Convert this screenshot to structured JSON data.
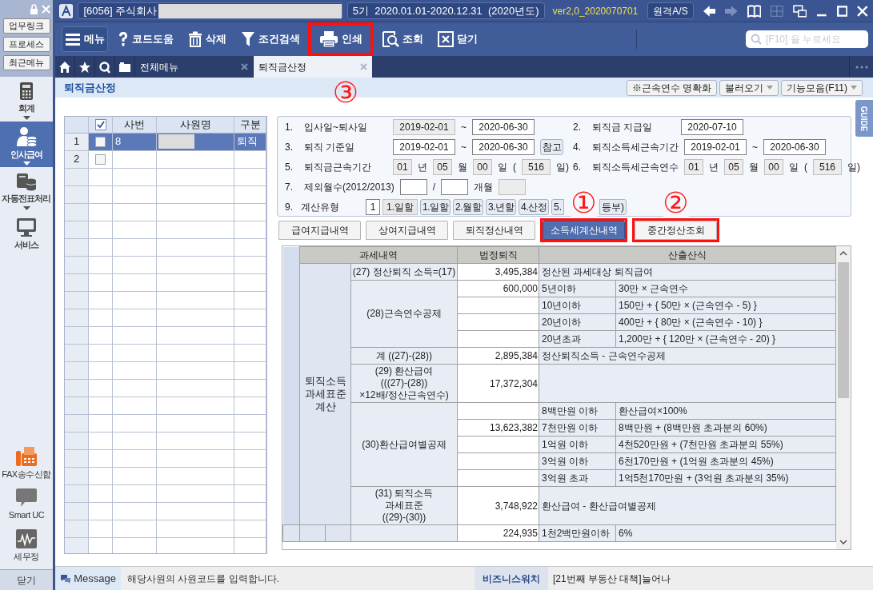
{
  "window": {
    "company": "[6056] 주식회사",
    "period": "5기  2020.01.01-2020.12.31  (2020년도)",
    "version": "ver2,0_2020070701",
    "remote_button": "원격A/S"
  },
  "quick_buttons": [
    "업무링크",
    "프로세스",
    "최근메뉴"
  ],
  "sidebar": {
    "items": [
      {
        "label": "회계",
        "kind": "calculator",
        "selected": false,
        "expandable": true
      },
      {
        "label": "인사급여",
        "kind": "person",
        "selected": true,
        "expandable": true
      },
      {
        "label": "자동전표처리",
        "kind": "database",
        "selected": false,
        "expandable": true
      },
      {
        "label": "서비스",
        "kind": "monitor",
        "selected": false,
        "expandable": false
      }
    ],
    "bottom_items": [
      {
        "label": "FAX송수신함",
        "kind": "fax"
      },
      {
        "label": "Smart UC",
        "kind": "chat"
      },
      {
        "label": "세무정",
        "kind": "chart"
      }
    ],
    "close_button": "닫기"
  },
  "toolbar": [
    {
      "label": "메뉴",
      "kind": "menu",
      "highlighted": false
    },
    {
      "label": "코드도움",
      "kind": "help",
      "highlighted": false
    },
    {
      "label": "삭제",
      "kind": "trash",
      "highlighted": false
    },
    {
      "label": "조건검색",
      "kind": "filter",
      "highlighted": false
    },
    {
      "label": "인쇄",
      "kind": "print",
      "highlighted": true,
      "callout": "③"
    },
    {
      "label": "조회",
      "kind": "lookup",
      "highlighted": false
    },
    {
      "label": "닫기",
      "kind": "close",
      "highlighted": false
    }
  ],
  "search": {
    "placeholder": "[F10] 을 누르세요"
  },
  "tabs": [
    {
      "label": "전체메뉴",
      "selected": false
    },
    {
      "label": "퇴직금산정",
      "selected": true
    }
  ],
  "page": {
    "title": "퇴직금산정",
    "buttons": [
      {
        "label": "※근속연수 명확화",
        "dropdown": false
      },
      {
        "label": "불러오기",
        "dropdown": true
      },
      {
        "label": "기능모음(F11)",
        "dropdown": true
      }
    ],
    "guide": "GUIDE"
  },
  "employee_grid": {
    "columns": [
      "사번",
      "사원명",
      "구분"
    ],
    "header_checked": true,
    "rows": [
      {
        "no": "1",
        "checked": false,
        "selected": true,
        "id": "8",
        "redacted": true,
        "type": "퇴직"
      },
      {
        "no": "2",
        "checked": false,
        "selected": false,
        "redacted": false
      }
    ]
  },
  "form": [
    {
      "left": [
        {
          "kind": "num",
          "text": "1."
        },
        {
          "kind": "label",
          "text": "입사일~퇴사일"
        },
        {
          "kind": "date",
          "value": "2019-02-01",
          "readonly": true
        },
        {
          "kind": "text",
          "text": "~"
        },
        {
          "kind": "date",
          "value": "2020-06-30",
          "readonly": false
        }
      ],
      "right": [
        {
          "kind": "num",
          "text": "2."
        },
        {
          "kind": "label",
          "text": "퇴직금 지급일"
        },
        {
          "kind": "date",
          "value": "2020-07-10",
          "readonly": false
        }
      ]
    },
    {
      "left": [
        {
          "kind": "num",
          "text": "3."
        },
        {
          "kind": "label",
          "text": "퇴직 기준일"
        },
        {
          "kind": "date",
          "value": "2019-02-01",
          "readonly": false
        },
        {
          "kind": "text",
          "text": "~"
        },
        {
          "kind": "date",
          "value": "2020-06-30",
          "readonly": false
        },
        {
          "kind": "button",
          "text": "참고"
        }
      ],
      "right": [
        {
          "kind": "num",
          "text": "4."
        },
        {
          "kind": "label",
          "text": "퇴직소득세근속기간"
        },
        {
          "kind": "date",
          "value": "2019-02-01",
          "readonly": false
        },
        {
          "kind": "text",
          "text": "~"
        },
        {
          "kind": "date",
          "value": "2020-06-30",
          "readonly": false
        }
      ]
    },
    {
      "left": [
        {
          "kind": "num",
          "text": "5."
        },
        {
          "kind": "label",
          "text": "퇴직금근속기간"
        },
        {
          "kind": "unit",
          "value": "01",
          "readonly": true
        },
        {
          "kind": "text",
          "text": "년"
        },
        {
          "kind": "unit",
          "value": "05",
          "readonly": true
        },
        {
          "kind": "text",
          "text": "월"
        },
        {
          "kind": "unit",
          "value": "00",
          "readonly": true
        },
        {
          "kind": "text",
          "text": "일"
        },
        {
          "kind": "text",
          "text": "("
        },
        {
          "kind": "days",
          "value": "516",
          "readonly": true
        },
        {
          "kind": "text",
          "text": "일)"
        }
      ],
      "right": [
        {
          "kind": "num",
          "text": "6."
        },
        {
          "kind": "label",
          "text": "퇴직소득세근속연수"
        },
        {
          "kind": "unit",
          "value": "01",
          "readonly": true
        },
        {
          "kind": "text",
          "text": "년"
        },
        {
          "kind": "unit",
          "value": "05",
          "readonly": true
        },
        {
          "kind": "text",
          "text": "월"
        },
        {
          "kind": "unit",
          "value": "00",
          "readonly": true
        },
        {
          "kind": "text",
          "text": "일"
        },
        {
          "kind": "text",
          "text": "("
        },
        {
          "kind": "days",
          "value": "516",
          "readonly": true
        },
        {
          "kind": "text",
          "text": "일)"
        }
      ]
    },
    {
      "left": [
        {
          "kind": "num",
          "text": "7."
        },
        {
          "kind": "label",
          "text": "제외월수(2012/2013)"
        },
        {
          "kind": "blank",
          "readonly": false
        },
        {
          "kind": "text",
          "text": "/"
        },
        {
          "kind": "blank",
          "readonly": false
        },
        {
          "kind": "text",
          "text": "개월"
        },
        {
          "kind": "blank",
          "readonly": true
        }
      ]
    },
    {
      "left": [
        {
          "kind": "num",
          "text": "9."
        },
        {
          "kind": "short_label",
          "text": "계산유형"
        },
        {
          "kind": "code",
          "value": "1",
          "readonly": false
        },
        {
          "kind": "tag",
          "text": "1.일할"
        },
        {
          "kind": "button",
          "text": "1.일할"
        },
        {
          "kind": "button",
          "text": "2.월할"
        },
        {
          "kind": "button",
          "text": "3.년할"
        },
        {
          "kind": "button",
          "text": "4.산정"
        },
        {
          "kind": "split_button",
          "text": "5.",
          "text_end": "등부)"
        }
      ]
    }
  ],
  "result_tabs": [
    {
      "label": "급여지급내역",
      "selected": false,
      "highlighted": false
    },
    {
      "label": "상여지급내역",
      "selected": false,
      "highlighted": false
    },
    {
      "label": "퇴직정산내역",
      "selected": false,
      "highlighted": false
    },
    {
      "label": "소득세계산내역",
      "selected": true,
      "highlighted": true,
      "callout": "①"
    },
    {
      "label": "중간정산조회",
      "selected": false,
      "highlighted": true,
      "callout": "②"
    }
  ],
  "tax_table": {
    "columns": [
      "과세내역",
      "법정퇴직",
      "산출산식"
    ],
    "category": "퇴직소득 과세표준 계산",
    "groups": [
      {
        "item": "(27) 정산퇴직 소득=(17)",
        "rows": [
          {
            "amount": "3,495,384",
            "formula": "정산된 과세대상 퇴직급여"
          }
        ]
      },
      {
        "item": "(28)근속연수공제",
        "rows": [
          {
            "amount": "600,000",
            "range": "5년이하",
            "formula": "30만 × 근속연수"
          },
          {
            "range": "10년이하",
            "formula": "150만 + { 50만 × (근속연수 - 5) }"
          },
          {
            "range": "20년이하",
            "formula": "400만 + { 80만 × (근속연수 - 10) }"
          },
          {
            "range": "20년초과",
            "formula": "1,200만 + { 120만 × (근속연수 - 20) }"
          }
        ]
      },
      {
        "item": "계 ((27)-(28))",
        "rows": [
          {
            "amount": "2,895,384",
            "formula": "정산퇴직소득 - 근속연수공제"
          }
        ]
      },
      {
        "item": "(29) 환산급여\n(((27)-(28))\n×12배/정산근속연수)",
        "rows": [
          {
            "amount": "17,372,304"
          }
        ]
      },
      {
        "item": "(30)환산급여별공제",
        "rows": [
          {
            "range": "8백만원 이하",
            "formula": "환산급여×100%"
          },
          {
            "amount": "13,623,382",
            "range": "7천만원 이하",
            "formula": "8백만원 + (8백만원 초과분의 60%)"
          },
          {
            "range": "1억원 이하",
            "formula": "4천520만원 + (7천만원 초과분의 55%)"
          },
          {
            "range": "3억원 이하",
            "formula": "6천170만원 + (1억원 초과분의 45%)"
          },
          {
            "range": "3억원 초과",
            "formula": "1억5천170만원 + (3억원 초과분의 35%)"
          }
        ]
      },
      {
        "item": "(31) 퇴직소득\n과세표준\n((29)-(30))",
        "rows": [
          {
            "amount": "3,748,922",
            "formula": "환산급여 - 환산급여별공제"
          }
        ]
      }
    ],
    "next_row": {
      "amount": "224,935",
      "range": "1천2백만원이하",
      "formula": "6%"
    }
  },
  "status_bar": {
    "message_label": "Message",
    "message": "해당사원의 사원코드를 입력합니다.",
    "news_label": "비즈니스워치",
    "news": "[21번째 부동산 대책]늘어나"
  }
}
